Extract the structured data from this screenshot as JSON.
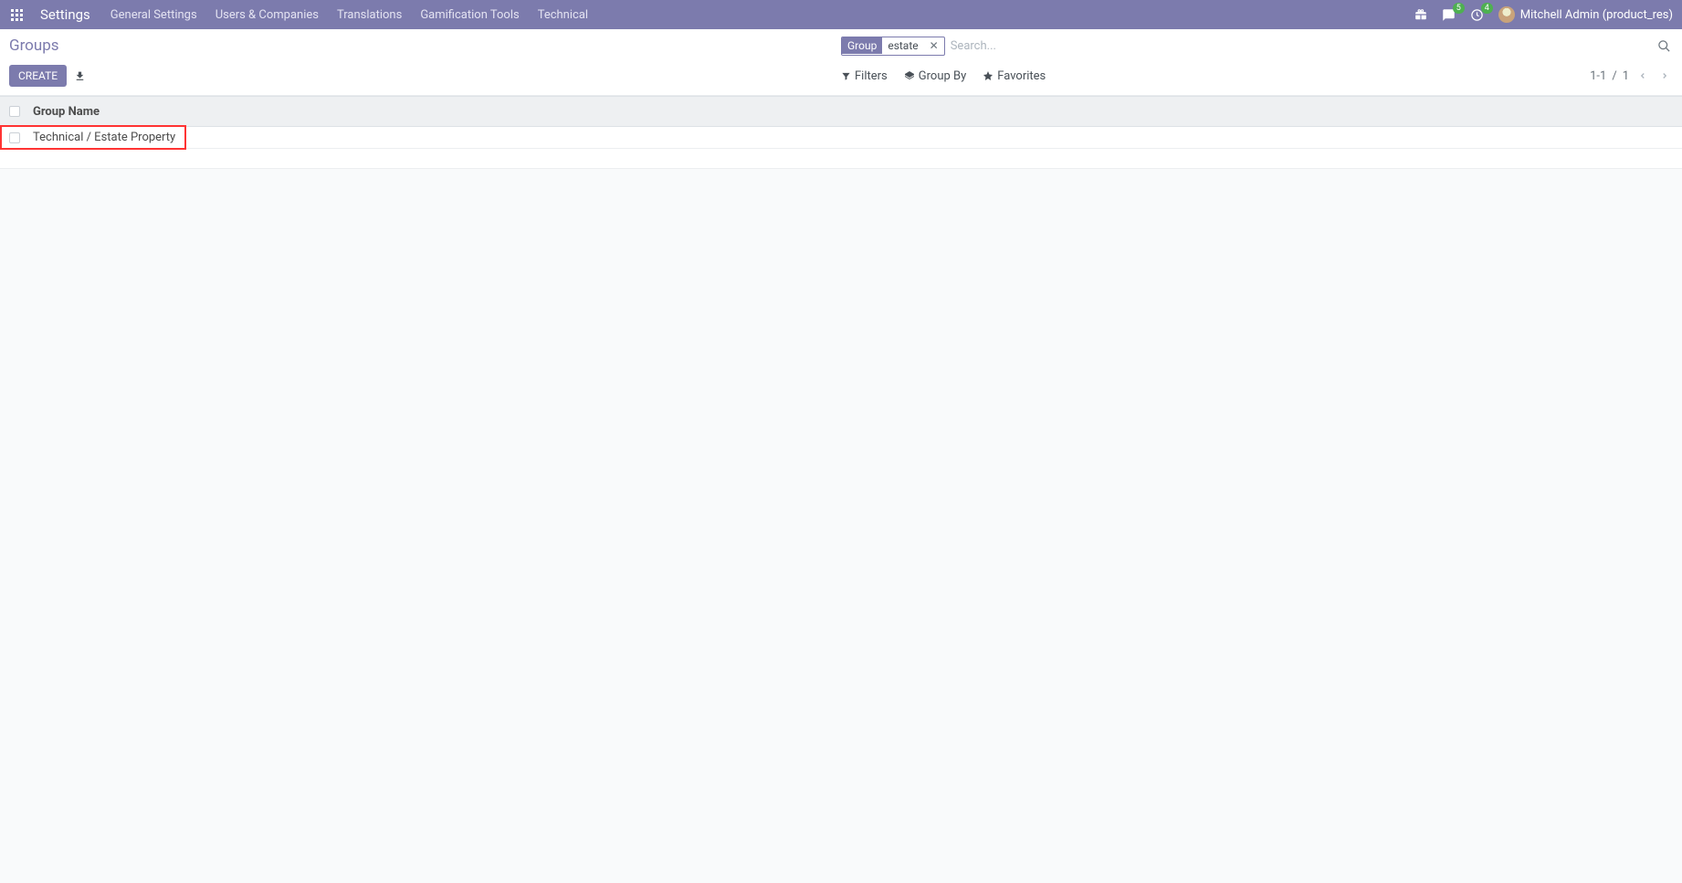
{
  "navbar": {
    "brand": "Settings",
    "menu": [
      "General Settings",
      "Users & Companies",
      "Translations",
      "Gamification Tools",
      "Technical"
    ],
    "messages_badge": "5",
    "activities_badge": "4",
    "user": "Mitchell Admin (product_res)"
  },
  "breadcrumb": "Groups",
  "search": {
    "facet_label": "Group",
    "facet_value": "estate",
    "placeholder": "Search..."
  },
  "buttons": {
    "create": "CREATE",
    "filters": "Filters",
    "group_by": "Group By",
    "favorites": "Favorites"
  },
  "pager": {
    "range": "1-1",
    "sep": "/",
    "total": "1"
  },
  "table": {
    "header": "Group Name",
    "rows": [
      {
        "name": "Technical / Estate Property"
      }
    ]
  }
}
